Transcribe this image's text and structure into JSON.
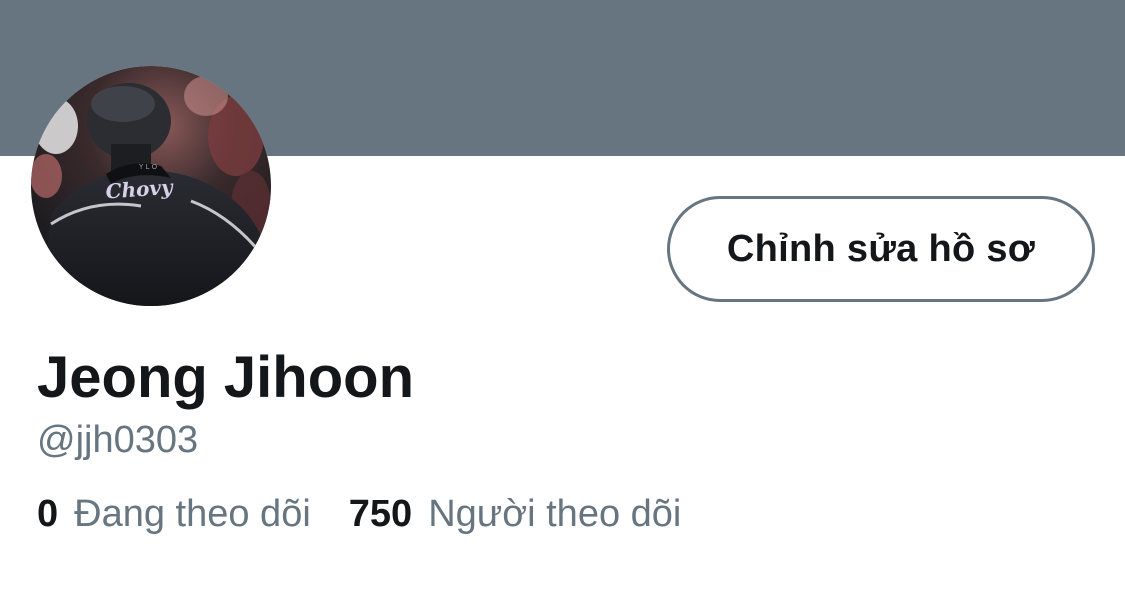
{
  "profile": {
    "display_name": "Jeong Jihoon",
    "handle": "@jjh0303",
    "avatar_jacket_text": "Chovy",
    "edit_button_label": "Chỉnh sửa hồ sơ"
  },
  "stats": {
    "following_count": "0",
    "following_label": "Đang theo dõi",
    "followers_count": "750",
    "followers_label": "Người theo dõi"
  },
  "colors": {
    "banner": "#66757f",
    "text_primary": "#14171a",
    "text_secondary": "#66757f",
    "button_border": "#66757f",
    "background": "#ffffff"
  },
  "icons": {
    "avatar": "profile-photo"
  }
}
